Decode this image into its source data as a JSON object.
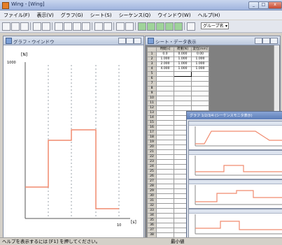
{
  "window": {
    "title": "Wing - [Wing]",
    "minimize_glyph": "_",
    "maximize_glyph": "□",
    "close_glyph": "x"
  },
  "menu": [
    "ファイル(F)",
    "表示(V)",
    "グラフ(G)",
    "シート(S)",
    "シーケンス(Q)",
    "ウインドウ(W)",
    "ヘルプ(H)"
  ],
  "toolbar": {
    "combo_value": "グループ名"
  },
  "graph_window": {
    "title": "グラフ・ウインドウ",
    "y_label": "[N]",
    "y_tick": "1000",
    "x_label": "[s]",
    "x_tick": "10"
  },
  "sheet_window": {
    "title": "シート・データ表示",
    "headers": [
      "",
      "時間[s]",
      "荷重[N]",
      "変位[mm]"
    ],
    "rows": [
      [
        "1",
        "0.0",
        "0.000",
        "0.00"
      ],
      [
        "2",
        "1.000",
        "1.000",
        "1.000"
      ],
      [
        "3",
        "2.000",
        "1.000",
        "1.000"
      ],
      [
        "4",
        "4.000",
        "1.000",
        "1.000"
      ]
    ],
    "row_numbers": [
      "5",
      "6",
      "7",
      "8",
      "9",
      "10",
      "11",
      "12",
      "13",
      "14",
      "15",
      "16",
      "17",
      "18",
      "19",
      "20",
      "21",
      "22",
      "23",
      "24",
      "25",
      "26",
      "27",
      "28",
      "29",
      "30",
      "31",
      "32",
      "33",
      "34",
      "35",
      "36",
      "37",
      "38"
    ]
  },
  "overlay_window": {
    "title": "グラフ 1/2/3/4 (シーケンスモニタ表示)"
  },
  "status": {
    "help": "ヘルプを表示するには [F1] を押してください。",
    "right": "最小値"
  },
  "colors": {
    "trace": "#f08a6e",
    "grid": "#9aa0aa"
  }
}
